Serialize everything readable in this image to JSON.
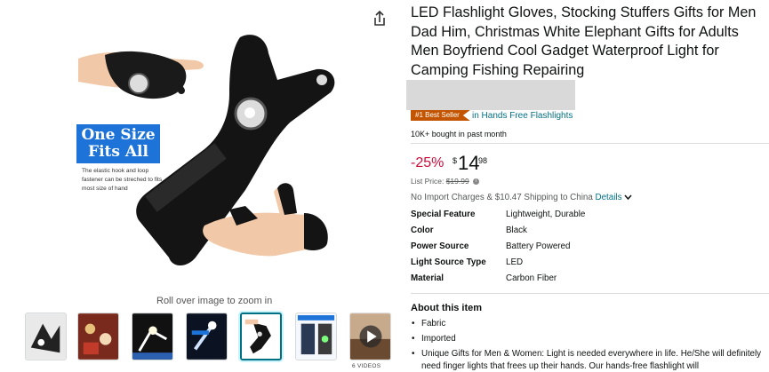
{
  "gallery": {
    "zoom_hint": "Roll over image to zoom in",
    "badge_line1": "One Size",
    "badge_line2": "Fits All",
    "badge_desc": "The elastic hook and loop fastener can be streched to fits most size of hand",
    "video_count": "6 VIDEOS",
    "thumbnail_count": 7,
    "selected_thumbnail": 5
  },
  "product": {
    "title": "LED Flashlight Gloves, Stocking Stuffers Gifts for Men Dad Him, Christmas White Elephant Gifts for Adults Men Boyfriend Cool Gadget Waterproof Light for Camping Fishing Repairing",
    "best_seller_badge": "#1 Best Seller",
    "best_seller_category": "in Hands Free Flashlights",
    "bought": "10K+ bought in past month",
    "discount": "-25%",
    "price_symbol": "$",
    "price_whole": "14",
    "price_fraction": "98",
    "list_price_label": "List Price:",
    "list_price_value": "$19.99",
    "shipping": "No Import Charges & $10.47 Shipping to China",
    "details_link": "Details",
    "specs": [
      {
        "label": "Special Feature",
        "value": "Lightweight, Durable"
      },
      {
        "label": "Color",
        "value": "Black"
      },
      {
        "label": "Power Source",
        "value": "Battery Powered"
      },
      {
        "label": "Light Source Type",
        "value": "LED"
      },
      {
        "label": "Material",
        "value": "Carbon Fiber"
      }
    ],
    "about_title": "About this item",
    "about_items": [
      "Fabric",
      "Imported",
      "Unique Gifts for Men & Women: Light is needed everywhere in life. He/She will definitely need finger lights that frees up their hands. Our hands-free flashlight will"
    ]
  },
  "colors": {
    "link": "#007185",
    "discount": "#CC0C39",
    "best_seller": "#C45500",
    "badge_blue": "#1e73d8"
  }
}
